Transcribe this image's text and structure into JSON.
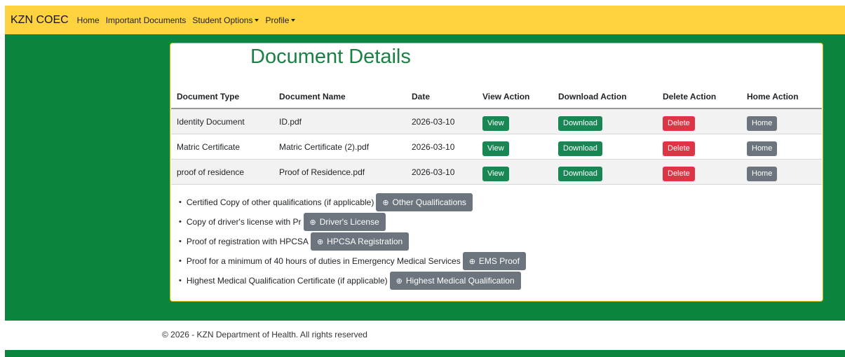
{
  "navbar": {
    "brand": "KZN COEC",
    "links": [
      {
        "label": "Home",
        "caret": false
      },
      {
        "label": "Important Documents",
        "caret": false
      },
      {
        "label": "Student Options",
        "caret": true
      },
      {
        "label": "Profile",
        "caret": true
      }
    ]
  },
  "card": {
    "title": "Document Details",
    "columns": [
      "Document Type",
      "Document Name",
      "Date",
      "View Action",
      "Download Action",
      "Delete Action",
      "Home Action"
    ],
    "rows": [
      {
        "type": "Identity Document",
        "name": "ID.pdf",
        "date": "2026-03-10",
        "view": "View",
        "download": "Download",
        "delete": "Delete",
        "home": "Home"
      },
      {
        "type": "Matric Certificate",
        "name": "Matric Certificate (2).pdf",
        "date": "2026-03-10",
        "view": "View",
        "download": "Download",
        "delete": "Delete",
        "home": "Home"
      },
      {
        "type": "proof of residence",
        "name": "Proof of Residence.pdf",
        "date": "2026-03-10",
        "view": "View",
        "download": "Download",
        "delete": "Delete",
        "home": "Home"
      }
    ],
    "requirements": [
      {
        "text": "Certified Copy of other qualifications (if applicable)",
        "button": "Other Qualifications",
        "icon": "plus-circle-icon"
      },
      {
        "text": "Copy of driver's license with Pr",
        "button": "Driver's License",
        "icon": "plus-circle-icon"
      },
      {
        "text": "Proof of registration with HPCSA",
        "button": "HPCSA Registration",
        "icon": "plus-circle-icon"
      },
      {
        "text": "Proof for a minimum of 40 hours of duties in Emergency Medical Services",
        "button": "EMS Proof",
        "icon": "plus-circle-icon"
      },
      {
        "text": "Highest Medical Qualification Certificate (if applicable)",
        "button": "Highest Medical Qualification",
        "icon": "plus-circle-icon"
      }
    ]
  },
  "footer": {
    "text": "© 2026 - KZN Department of Health. All rights reserved"
  },
  "colors": {
    "navbar": "#ffd23f",
    "main_green": "#0b843e",
    "title_green": "#1a8043",
    "button_green": "#198754",
    "button_red": "#dc3545",
    "button_gray": "#6c757d"
  }
}
